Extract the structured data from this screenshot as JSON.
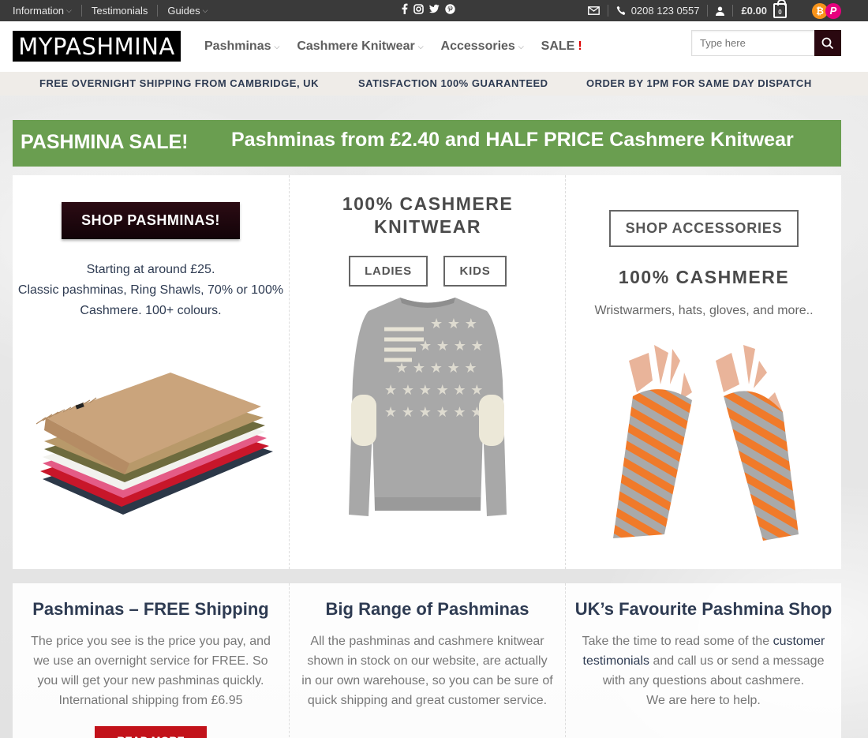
{
  "topbar": {
    "links": [
      "Information",
      "Testimonials",
      "Guides"
    ],
    "phone": "0208 123 0557",
    "cart_total": "£0.00",
    "cart_count": "0",
    "social_icons": [
      "facebook-icon",
      "instagram-icon",
      "twitter-icon",
      "pinterest-icon"
    ]
  },
  "header": {
    "logo": "MYPASHMINA",
    "nav": [
      "Pashminas",
      "Cashmere Knitwear",
      "Accessories"
    ],
    "nav_sale": "SALE",
    "nav_sale_mark": "!",
    "search_placeholder": "Type here"
  },
  "usp": [
    "FREE OVERNIGHT SHIPPING FROM CAMBRIDGE, UK",
    "SATISFACTION 100% GUARANTEED",
    "ORDER BY 1PM FOR SAME DAY DISPATCH"
  ],
  "sale_banner": {
    "title": "PASHMINA SALE!",
    "subtitle": "Pashminas from £2.40 and HALF PRICE Cashmere Knitwear"
  },
  "panels": {
    "pashminas": {
      "button": "SHOP PASHMINAS!",
      "line1": "Starting at around £25.",
      "line2": "Classic pashminas, Ring Shawls, 70% or 100%",
      "line3": "Cashmere. 100+ colours."
    },
    "knitwear": {
      "heading_line1": "100% CASHMERE",
      "heading_line2": "KNITWEAR",
      "btn_ladies": "LADIES",
      "btn_kids": "KIDS"
    },
    "accessories": {
      "button": "SHOP ACCESSORIES",
      "heading": "100% CASHMERE",
      "sub": "Wristwarmers, hats, gloves, and more.."
    }
  },
  "info": [
    {
      "title": "Pashminas – FREE Shipping",
      "body": "The price you see is the price you pay, and we use an overnight service for FREE. So you will get your new pashminas quickly. International shipping from £6.95",
      "button": "READ MORE"
    },
    {
      "title": "Big Range of Pashminas",
      "body": "All the pashminas and cashmere knitwear shown in stock on our website, are actually in our own warehouse, so you can be sure of quick shipping and great customer service."
    },
    {
      "title": "UK’s Favourite Pashmina Shop",
      "body_pre": "Take the time to read some of the",
      "link": "customer testimonials",
      "body_post": "and call us or send a message with any questions about cashmere.",
      "body_end": "We are here to help."
    }
  ],
  "colors": {
    "topbar": "#3a3a3a",
    "sale_banner": "#6a9e50",
    "dark_button": "#2c0c14",
    "heading_navy": "#2e3b52",
    "read_more": "#c2121a"
  }
}
